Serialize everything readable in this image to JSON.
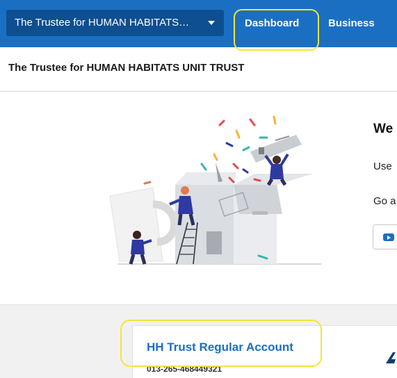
{
  "header": {
    "org_selector_label": "The Trustee for HUMAN HABITATS…",
    "tabs": [
      {
        "label": "Dashboard",
        "active": true
      },
      {
        "label": "Business",
        "active": false
      }
    ]
  },
  "entity": {
    "title": "The Trustee for HUMAN HABITATS UNIT TRUST"
  },
  "welcome": {
    "heading": "We",
    "line1": "Use",
    "line2": "Go a"
  },
  "account": {
    "name": "HH Trust Regular Account",
    "number": "013-265-468449321"
  },
  "colors": {
    "brand_blue": "#1b6fc2",
    "selector_dark": "#0d4f91",
    "highlight_yellow": "#f2e63b"
  },
  "icons": {
    "dropdown": "caret-down-icon",
    "video": "video-play-icon",
    "brand": "brand-logo-icon"
  }
}
